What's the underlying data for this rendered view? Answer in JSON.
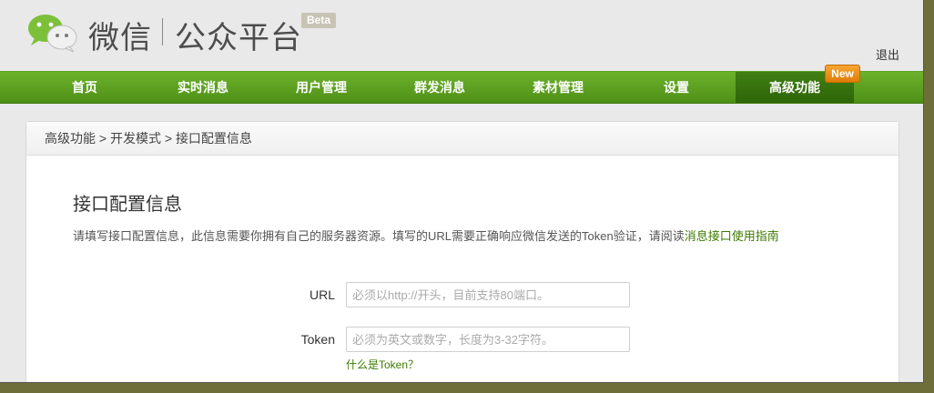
{
  "header": {
    "logo_text": "微信",
    "logo_sub": "公众平台",
    "beta": "Beta",
    "logout": "退出"
  },
  "nav": {
    "items": [
      {
        "label": "首页"
      },
      {
        "label": "实时消息"
      },
      {
        "label": "用户管理"
      },
      {
        "label": "群发消息"
      },
      {
        "label": "素材管理"
      },
      {
        "label": "设置"
      },
      {
        "label": "高级功能"
      }
    ],
    "new_badge": "New"
  },
  "breadcrumb": {
    "items": [
      "高级功能",
      "开发模式",
      "接口配置信息"
    ],
    "sep": " > "
  },
  "main": {
    "title": "接口配置信息",
    "desc": "请填写接口配置信息，此信息需要你拥有自己的服务器资源。填写的URL需要正确响应微信发送的Token验证，请阅读",
    "desc_link": "消息接口使用指南"
  },
  "form": {
    "url_label": "URL",
    "url_placeholder": "必须以http://开头，目前支持80端口。",
    "token_label": "Token",
    "token_placeholder": "必须为英文或数字，长度为3-32字符。",
    "token_help": "什么是Token？"
  },
  "colors": {
    "nav_green": "#5aa021",
    "nav_active": "#3a7510",
    "new_badge": "#f39a1e",
    "link_green": "#3e7a00"
  }
}
